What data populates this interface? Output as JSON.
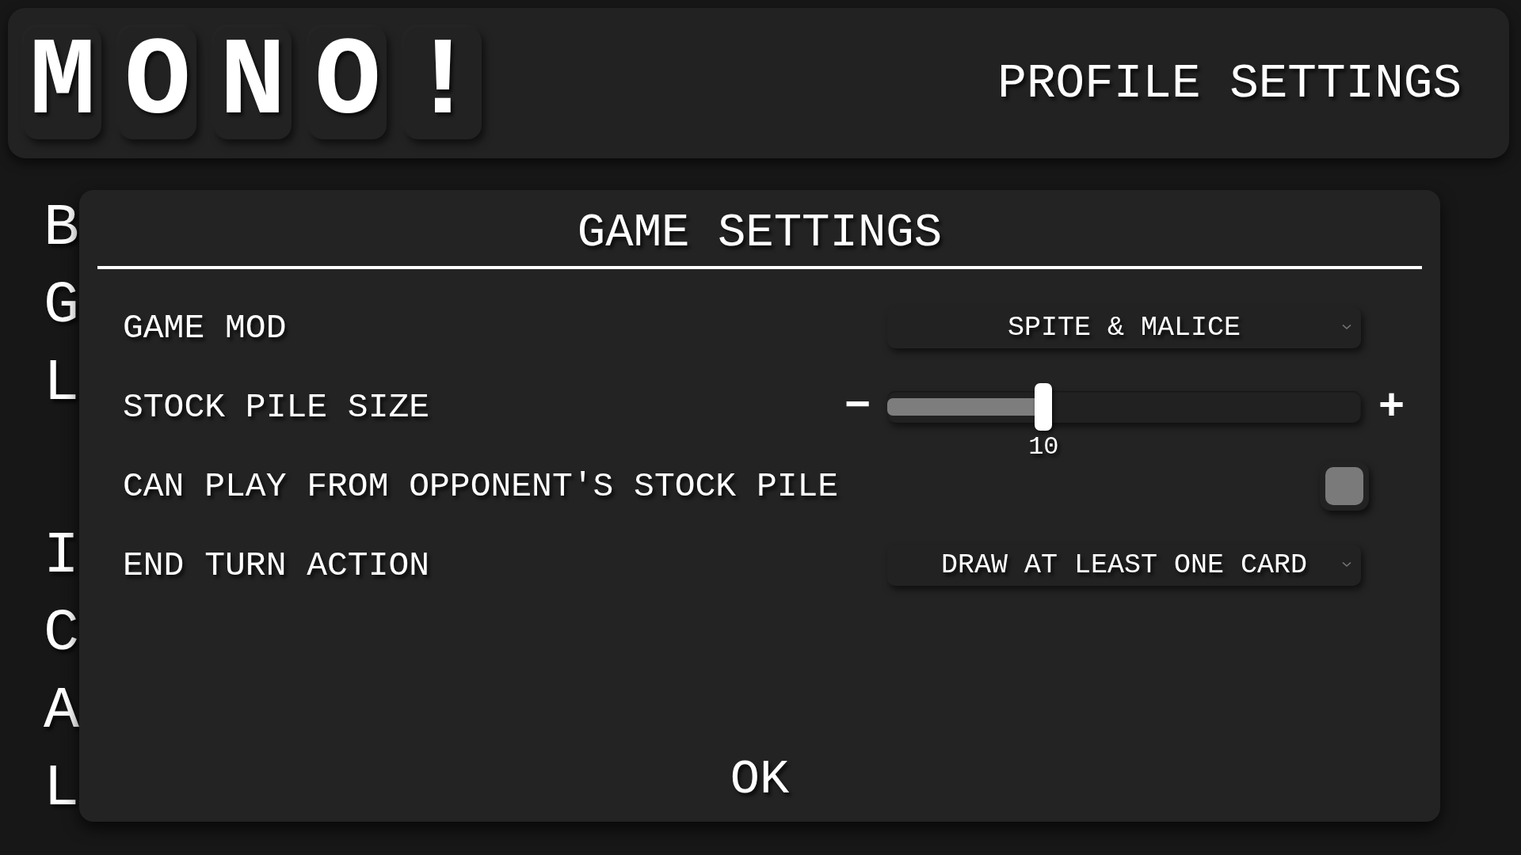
{
  "header": {
    "logo_tiles": [
      "M",
      "O",
      "N",
      "O",
      "!"
    ],
    "title": "PROFILE SETTINGS"
  },
  "sidebar": {
    "groups": [
      {
        "items": [
          "B",
          "G",
          "L"
        ]
      },
      {
        "items": [
          "I",
          "C",
          "A",
          "L"
        ]
      }
    ]
  },
  "dialog": {
    "title": "GAME SETTINGS",
    "settings": [
      {
        "kind": "dropdown",
        "label": "GAME MOD",
        "value": "SPITE & MALICE"
      },
      {
        "kind": "slider",
        "label": "STOCK PILE SIZE",
        "decrease": "−",
        "increase": "+",
        "level": 0.33,
        "reading": "10"
      },
      {
        "kind": "checkbox",
        "label": "CAN PLAY FROM OPPONENT'S STOCK PILE",
        "checked": false
      },
      {
        "kind": "dropdown",
        "label": "END TURN ACTION",
        "value": "DRAW AT LEAST ONE CARD"
      }
    ],
    "ok_button": "OK"
  }
}
